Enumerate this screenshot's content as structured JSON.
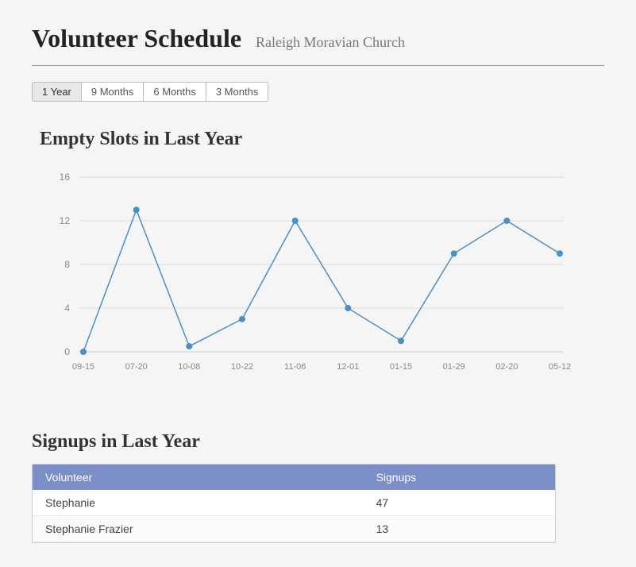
{
  "header": {
    "title": "Volunteer Schedule",
    "subtitle": "Raleigh Moravian Church"
  },
  "filters": {
    "buttons": [
      {
        "label": "1 Year",
        "active": true
      },
      {
        "label": "9 Months",
        "active": false
      },
      {
        "label": "6 Months",
        "active": false
      },
      {
        "label": "3 Months",
        "active": false
      }
    ]
  },
  "chart": {
    "title": "Empty Slots in Last Year",
    "xLabels": [
      "09-15",
      "07-20",
      "10-08",
      "10-22",
      "11-06",
      "12-01",
      "01-15",
      "01-29",
      "02-20",
      "05-12"
    ],
    "yLabels": [
      "0",
      "4",
      "8",
      "12",
      "16"
    ],
    "data": [
      {
        "x": "09-15",
        "y": 0
      },
      {
        "x": "07-20",
        "y": 13
      },
      {
        "x": "10-08",
        "y": 0.5
      },
      {
        "x": "10-22",
        "y": 3
      },
      {
        "x": "11-06",
        "y": 12
      },
      {
        "x": "12-01",
        "y": 4
      },
      {
        "x": "01-15",
        "y": 1
      },
      {
        "x": "01-29",
        "y": 9
      },
      {
        "x": "02-20",
        "y": 12
      },
      {
        "x": "05-12",
        "y": 9
      }
    ],
    "dataPoints": [
      0,
      13,
      0.5,
      3,
      12,
      4,
      1,
      9,
      12,
      9
    ]
  },
  "signups": {
    "title": "Signups in Last Year",
    "columns": [
      "Volunteer",
      "Signups"
    ],
    "rows": [
      {
        "volunteer": "Stephanie",
        "signups": "47"
      },
      {
        "volunteer": "Stephanie Frazier",
        "signups": "13"
      }
    ]
  }
}
